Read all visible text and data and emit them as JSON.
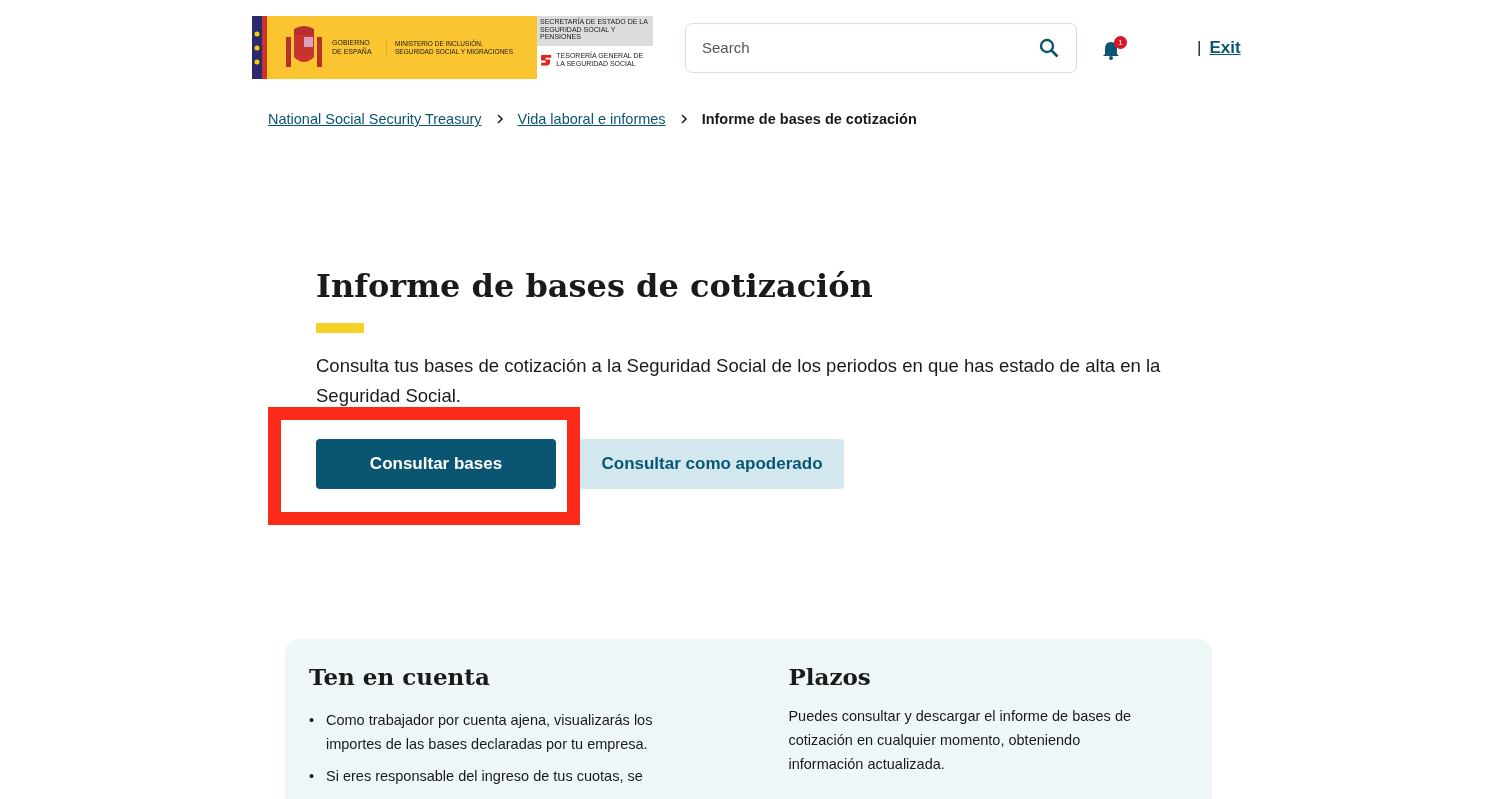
{
  "logo": {
    "government": "GOBIERNO DE ESPAÑA",
    "ministry": "MINISTERIO DE INCLUSIÓN, SEGURIDAD SOCIAL Y MIGRACIONES",
    "secretariat": "SECRETARÍA DE ESTADO DE LA SEGURIDAD SOCIAL Y PENSIONES",
    "treasury": "TESORERÍA GENERAL DE LA SEGURIDAD SOCIAL"
  },
  "search": {
    "placeholder": "Search"
  },
  "notifications": {
    "count": "1"
  },
  "exit": {
    "separator": "|",
    "label": "Exit"
  },
  "breadcrumb": [
    {
      "label": "National Social Security Treasury",
      "link": true
    },
    {
      "label": "Vida laboral e informes",
      "link": true
    },
    {
      "label": "Informe de bases de cotización",
      "link": false
    }
  ],
  "page": {
    "title": "Informe de bases de cotización",
    "description": "Consulta tus bases de cotización a la Seguridad Social de los periodos en que has estado de alta en la Seguridad Social."
  },
  "buttons": [
    {
      "label": "Consultar bases",
      "kind": "primary",
      "highlighted": true
    },
    {
      "label": "Consultar como apoderado",
      "kind": "secondary",
      "highlighted": false
    }
  ],
  "info": {
    "left": {
      "title": "Ten en cuenta",
      "items": [
        {
          "marker": "•",
          "text": "Como trabajador por cuenta ajena, visualizarás los importes de las bases declaradas por tu empresa."
        },
        {
          "marker": "•",
          "text": "Si eres responsable del ingreso de tus cuotas, se"
        }
      ]
    },
    "right": {
      "title": "Plazos",
      "text": "Puedes consultar y descargar el informe de bases de cotización en cualquier momento, obteniendo información actualizada."
    }
  }
}
